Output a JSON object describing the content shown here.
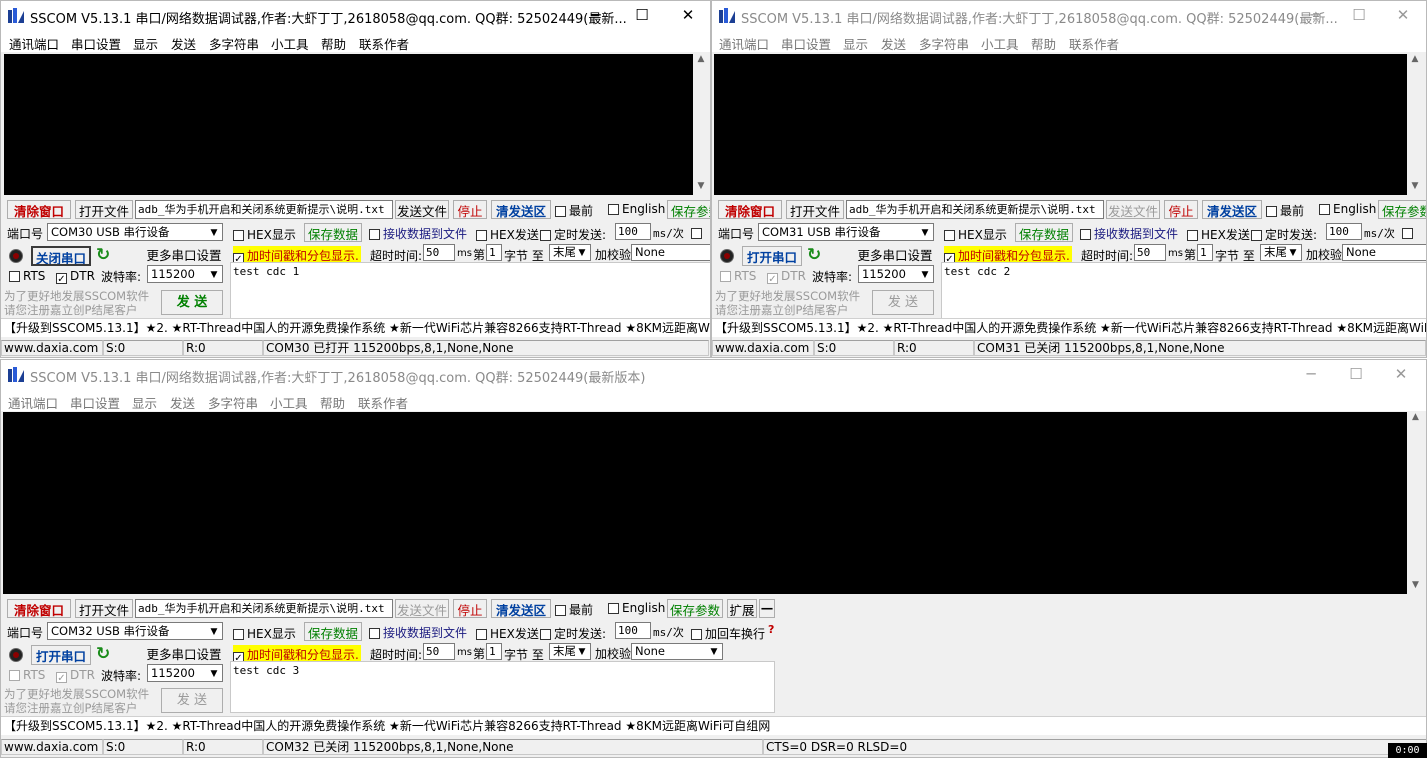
{
  "app": {
    "title_short": "SSCOM V5.13.1 串口/网络数据调试器,作者:大虾丁丁,2618058@qq.com. QQ群:  52502449(最新...",
    "title_full": "SSCOM V5.13.1 串口/网络数据调试器,作者:大虾丁丁,2618058@qq.com. QQ群:  52502449(最新版本)",
    "menu": [
      "通讯端口",
      "串口设置",
      "显示",
      "发送",
      "多字符串",
      "小工具",
      "帮助",
      "联系作者"
    ],
    "controls": {
      "minimize": "─",
      "maximize": "☐",
      "close": "✕"
    }
  },
  "common": {
    "clear_window": "清除窗口",
    "open_file": "打开文件",
    "file_path": "adb_华为手机开启和关闭系统更新提示\\说明.txt",
    "send_file": "发送文件",
    "stop": "停止",
    "clear_send": "清发送区",
    "latest": "最前",
    "english": "English",
    "save_params": "保存参数",
    "expand": "扩展",
    "collapse": "—",
    "port_label": "端口号",
    "more_settings": "更多串口设置",
    "rts": "RTS",
    "dtr": "DTR",
    "baud_label": "波特率:",
    "baud_value": "115200",
    "hex_display": "HEX显示",
    "save_data": "保存数据",
    "recv_to_file": "接收数据到文件",
    "hex_send": "HEX发送",
    "timed_send": "定时发送:",
    "timed_value": "100",
    "timed_unit": "ms/次",
    "add_crlf": "加回车换行",
    "timestamp": "加时间戳和分包显示.",
    "timeout_label": "超时时间:",
    "timeout_value": "50",
    "timeout_unit": "ms",
    "nth_label": "第",
    "nth_value": "1",
    "byte_to": "字节 至",
    "end_value": "末尾",
    "checksum_label": "加校验",
    "checksum_value": "None",
    "promo_line1": "为了更好地发展SSCOM软件",
    "promo_line2": "请您注册嘉立创P结尾客户",
    "send": "发 送",
    "ticker": "【升级到SSCOM5.13.1】★2. ★RT-Thread中国人的开源免费操作系统 ★新一代WiFi芯片兼容8266支持RT-Thread ★8KM远距离WiFi可自组网",
    "website": "www.daxia.com",
    "s_count": "S:0",
    "r_count": "R:0"
  },
  "windows": [
    {
      "port": "COM30 USB 串行设备",
      "open_button": "关闭串口",
      "send_text": "test cdc 1",
      "status": "COM30 已打开  115200bps,8,1,None,None",
      "active": true
    },
    {
      "port": "COM31 USB 串行设备",
      "open_button": "打开串口",
      "send_text": "test cdc 2",
      "status": "COM31 已关闭  115200bps,8,1,None,None",
      "active": false
    },
    {
      "port": "COM32 USB 串行设备",
      "open_button": "打开串口",
      "send_text": "test cdc 3",
      "status": "COM32 已关闭  115200bps,8,1,None,None",
      "lines": "CTS=0 DSR=0 RLSD=0",
      "active": false
    }
  ],
  "taskbar_clock": "0:00"
}
